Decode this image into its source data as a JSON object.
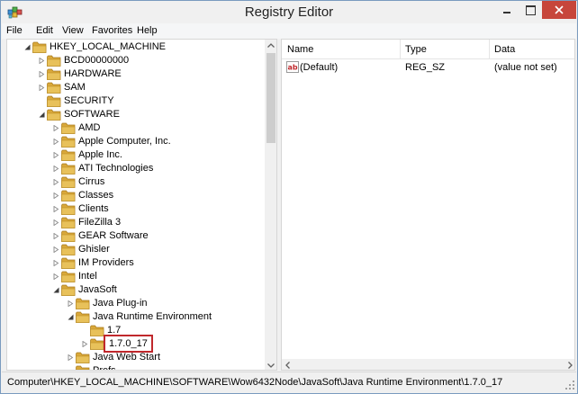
{
  "window": {
    "title": "Registry Editor"
  },
  "menu": [
    {
      "label": "File"
    },
    {
      "label": "Edit"
    },
    {
      "label": "View"
    },
    {
      "label": "Favorites"
    },
    {
      "label": "Help"
    }
  ],
  "tree": [
    {
      "label": "HKEY_LOCAL_MACHINE",
      "level": 1,
      "state": "expanded"
    },
    {
      "label": "BCD00000000",
      "level": 2,
      "state": "collapsed"
    },
    {
      "label": "HARDWARE",
      "level": 2,
      "state": "collapsed"
    },
    {
      "label": "SAM",
      "level": 2,
      "state": "collapsed"
    },
    {
      "label": "SECURITY",
      "level": 2,
      "state": "none"
    },
    {
      "label": "SOFTWARE",
      "level": 2,
      "state": "expanded"
    },
    {
      "label": "AMD",
      "level": 3,
      "state": "collapsed"
    },
    {
      "label": "Apple Computer, Inc.",
      "level": 3,
      "state": "collapsed"
    },
    {
      "label": "Apple Inc.",
      "level": 3,
      "state": "collapsed"
    },
    {
      "label": "ATI Technologies",
      "level": 3,
      "state": "collapsed"
    },
    {
      "label": "Cirrus",
      "level": 3,
      "state": "collapsed"
    },
    {
      "label": "Classes",
      "level": 3,
      "state": "collapsed"
    },
    {
      "label": "Clients",
      "level": 3,
      "state": "collapsed"
    },
    {
      "label": "FileZilla 3",
      "level": 3,
      "state": "collapsed"
    },
    {
      "label": "GEAR Software",
      "level": 3,
      "state": "collapsed"
    },
    {
      "label": "Ghisler",
      "level": 3,
      "state": "collapsed"
    },
    {
      "label": "IM Providers",
      "level": 3,
      "state": "collapsed"
    },
    {
      "label": "Intel",
      "level": 3,
      "state": "collapsed"
    },
    {
      "label": "JavaSoft",
      "level": 3,
      "state": "expanded"
    },
    {
      "label": "Java Plug-in",
      "level": 4,
      "state": "collapsed"
    },
    {
      "label": "Java Runtime Environment",
      "level": 4,
      "state": "expanded"
    },
    {
      "label": "1.7",
      "level": 5,
      "state": "none"
    },
    {
      "label": "1.7.0_17",
      "level": 5,
      "state": "collapsed",
      "selected": true
    },
    {
      "label": "Java Web Start",
      "level": 4,
      "state": "collapsed"
    },
    {
      "label": "Prefs",
      "level": 4,
      "state": "none"
    }
  ],
  "columns": [
    {
      "label": "Name"
    },
    {
      "label": "Type"
    },
    {
      "label": "Data"
    }
  ],
  "values": [
    {
      "name": "(Default)",
      "type": "REG_SZ",
      "data": "(value not set)",
      "icon": "string-value-icon"
    }
  ],
  "status": {
    "path": "Computer\\HKEY_LOCAL_MACHINE\\SOFTWARE\\Wow6432Node\\JavaSoft\\Java Runtime Environment\\1.7.0_17"
  },
  "colors": {
    "close_button": "#c7463b",
    "selection_outline": "#c0282c",
    "folder": "#e8c15a"
  }
}
